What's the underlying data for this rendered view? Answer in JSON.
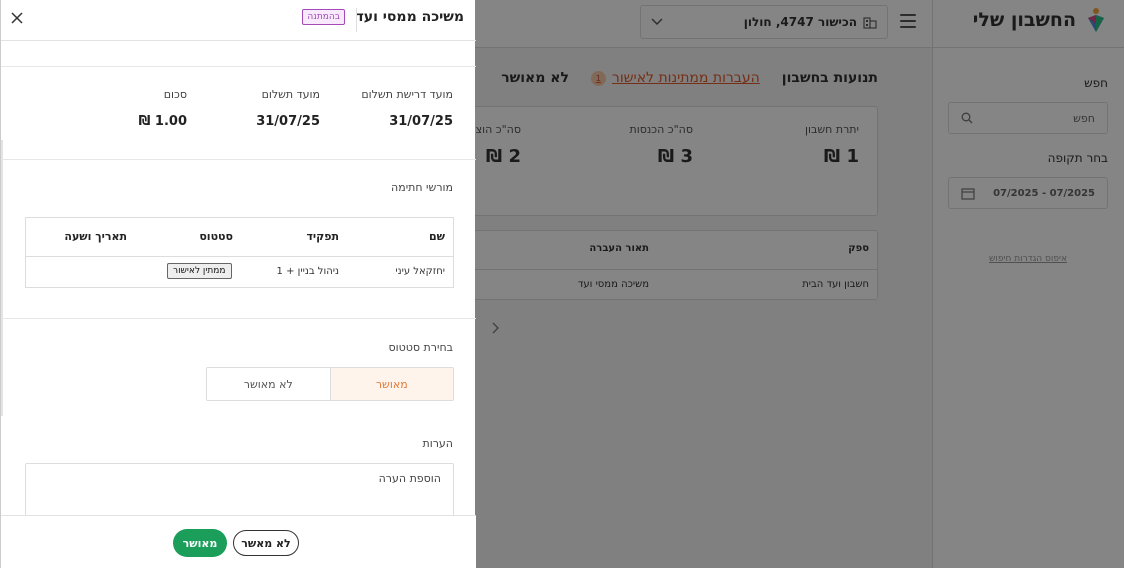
{
  "app": {
    "title": "החשבון שלי",
    "building": "הכישור 4747, חולון",
    "sidebar": {
      "search_label": "חפש",
      "search_placeholder": "חפש",
      "period_label": "בחר תקופה",
      "period_value": "07/2025 - 07/2025",
      "reset_link": "איפוס הגדרות חיפוש"
    },
    "tabs": [
      {
        "label": "תנועות בחשבון"
      },
      {
        "label": "העברות ממתינות לאישור",
        "count": "1"
      },
      {
        "label": "לא מאושר"
      }
    ],
    "stats": [
      {
        "label": "יתרת חשבון",
        "value": "1 ₪"
      },
      {
        "label": "סה\"כ הכנסות",
        "value": "3 ₪"
      },
      {
        "label": "סה\"כ הוצ",
        "value": "2 ₪"
      }
    ],
    "transactions": {
      "headers": {
        "supplier": "ספק",
        "description": "תאור העברה"
      },
      "rows": [
        {
          "supplier": "חשבון ועד הבית",
          "description": "משיכה ממסי ועד"
        }
      ]
    }
  },
  "drawer": {
    "title": "משיכה ממסי ועד",
    "badge": "בהמתנה",
    "payment": {
      "request_date_label": "מועד דרישת תשלום",
      "request_date": "31/07/25",
      "due_date_label": "מועד תשלום",
      "due_date": "31/07/25",
      "amount_label": "סכום",
      "amount": "1.00 ₪"
    },
    "signatories": {
      "title": "מורשי חתימה",
      "headers": {
        "name": "שם",
        "role": "תפקיד",
        "status": "סטטוס",
        "datetime": "תאריך ושעה"
      },
      "rows": [
        {
          "name": "יחזקאל עיני",
          "role": "ניהול בניין + 1",
          "status": "ממתין לאישור",
          "datetime": ""
        }
      ]
    },
    "status_select": {
      "title": "בחירת סטטוס",
      "approved": "מאושר",
      "not_approved": "לא מאושר",
      "selected": "approved"
    },
    "notes": {
      "title": "הערות",
      "placeholder": "הוספת הערה"
    },
    "footer": {
      "approve": "מאושר",
      "reject": "לא מאשר"
    }
  },
  "colors": {
    "accent": "#e05a2b",
    "approve_green": "#1a9e5a",
    "badge_purple": "#a34ab8"
  }
}
